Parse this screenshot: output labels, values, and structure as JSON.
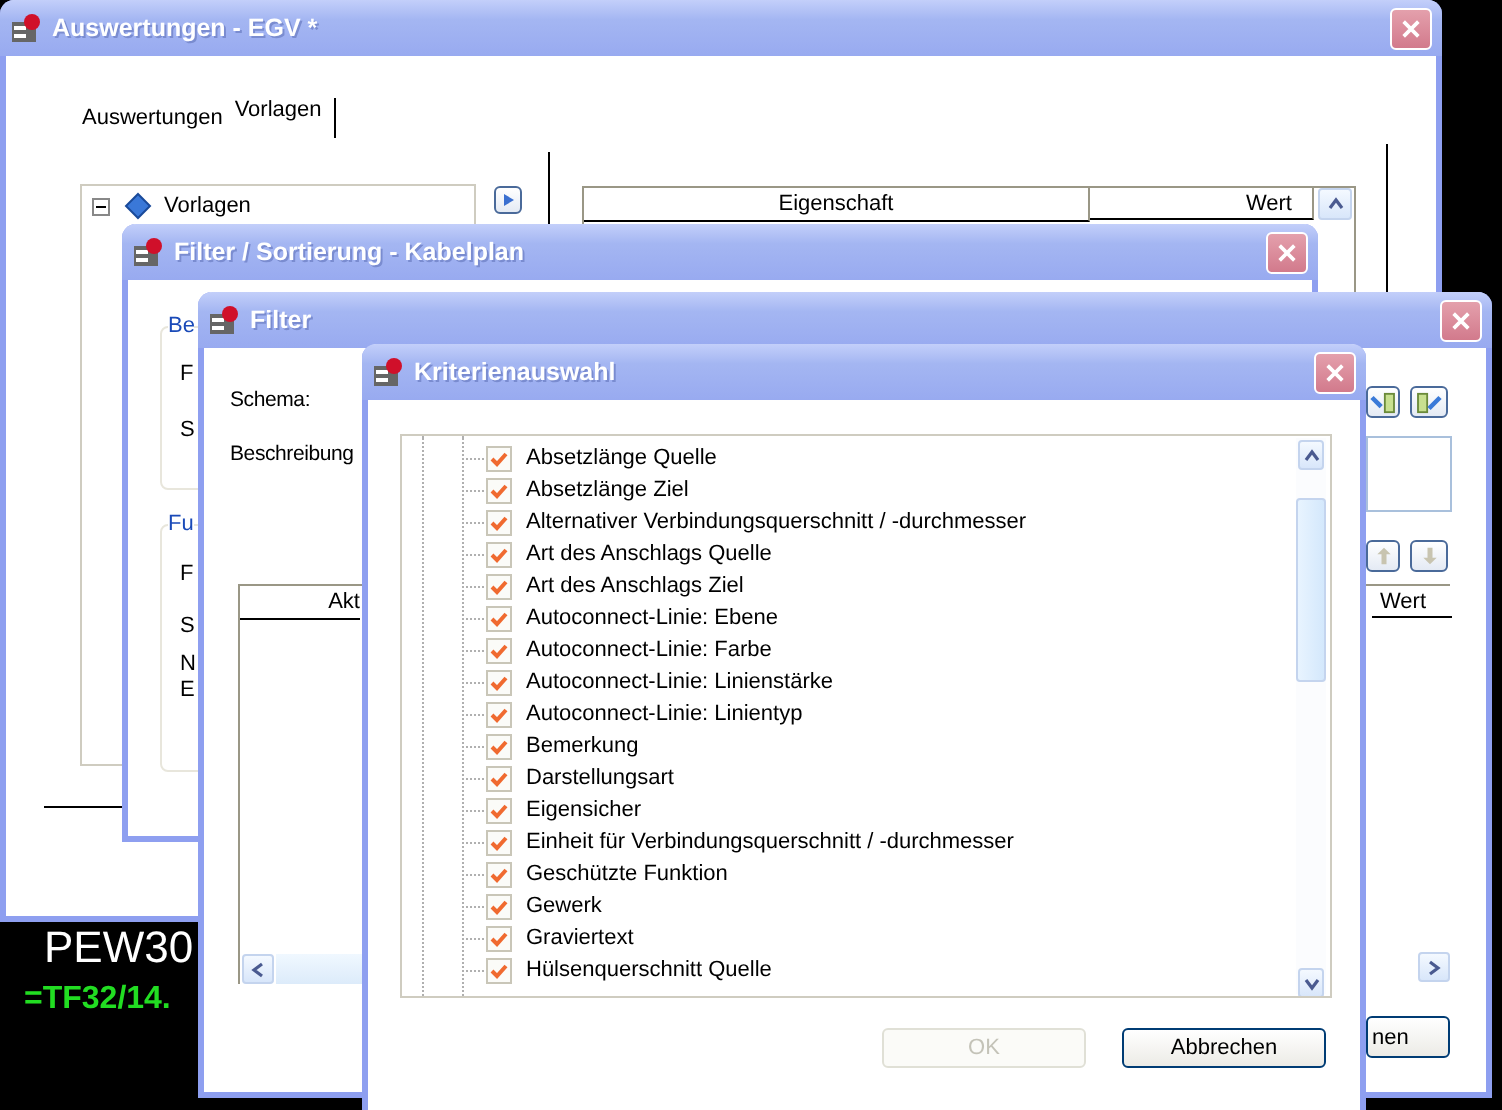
{
  "desktop_labels": [
    {
      "text": "PEW30",
      "color": "#ffffff"
    },
    {
      "text": "=TF32/14.",
      "color": "#22dd22"
    }
  ],
  "main_window": {
    "title": "Auswertungen - EGV *",
    "tabs": [
      {
        "label": "Auswertungen",
        "selected": false
      },
      {
        "label": "Vorlagen",
        "selected": true
      }
    ],
    "tree": [
      {
        "label": "Vorlagen",
        "expanded": true
      }
    ],
    "properties_table": {
      "columns": [
        "Eigenschaft",
        "Wert"
      ]
    }
  },
  "filter_sort_window": {
    "title": "Filter / Sortierung - Kabelplan",
    "groups": [
      {
        "title": "Be",
        "labels": [
          "F",
          "S"
        ]
      },
      {
        "title": "Fu",
        "labels": [
          "F",
          "S",
          "N",
          "E"
        ]
      }
    ]
  },
  "filter_window": {
    "title": "Filter",
    "fields": [
      "Schema:",
      "Beschreibung"
    ],
    "table": {
      "columns": [
        "Akt",
        "Wert"
      ]
    },
    "button": "nen"
  },
  "criteria_window": {
    "title": "Kriterienauswahl",
    "items": [
      {
        "label": "Absetzlänge Quelle",
        "checked": true
      },
      {
        "label": "Absetzlänge Ziel",
        "checked": true
      },
      {
        "label": "Alternativer Verbindungsquerschnitt / -durchmesser",
        "checked": true
      },
      {
        "label": "Art des Anschlags Quelle",
        "checked": true
      },
      {
        "label": "Art des Anschlags Ziel",
        "checked": true
      },
      {
        "label": "Autoconnect-Linie: Ebene",
        "checked": true
      },
      {
        "label": "Autoconnect-Linie: Farbe",
        "checked": true
      },
      {
        "label": "Autoconnect-Linie: Linienstärke",
        "checked": true
      },
      {
        "label": "Autoconnect-Linie: Linientyp",
        "checked": true
      },
      {
        "label": "Bemerkung",
        "checked": true
      },
      {
        "label": "Darstellungsart",
        "checked": true
      },
      {
        "label": "Eigensicher",
        "checked": true
      },
      {
        "label": "Einheit für Verbindungsquerschnitt / -durchmesser",
        "checked": true
      },
      {
        "label": "Geschützte Funktion",
        "checked": true
      },
      {
        "label": "Gewerk",
        "checked": true
      },
      {
        "label": "Graviertext",
        "checked": true
      },
      {
        "label": "Hülsenquerschnitt Quelle",
        "checked": true
      }
    ],
    "buttons": [
      {
        "label": "OK",
        "disabled": true
      },
      {
        "label": "Abbrechen",
        "disabled": false
      }
    ]
  }
}
